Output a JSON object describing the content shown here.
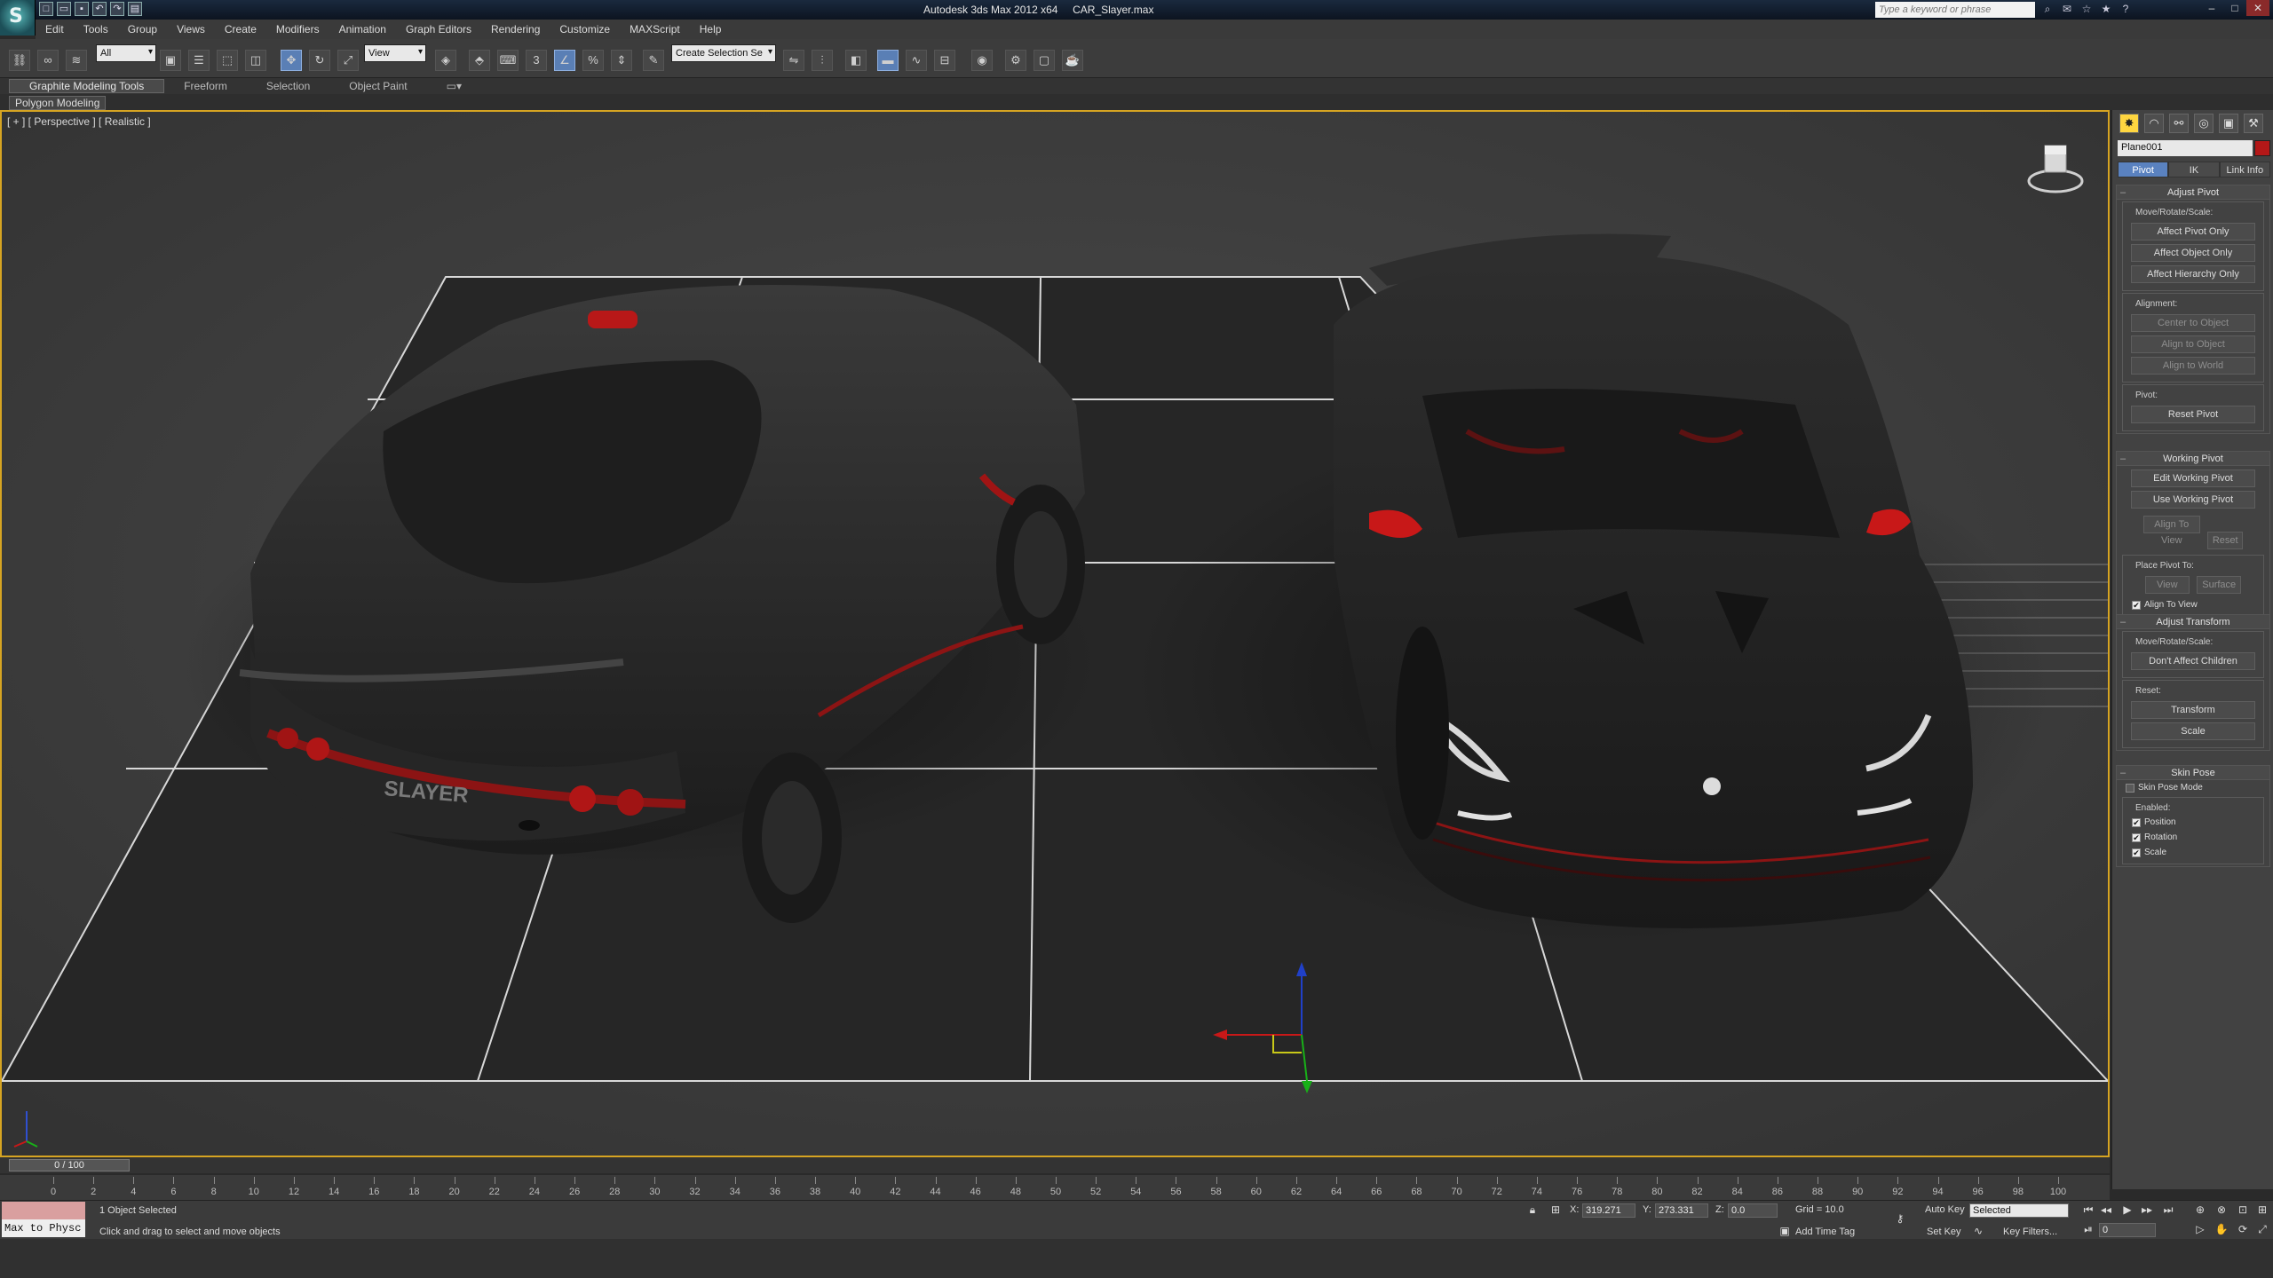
{
  "window": {
    "title_app": "Autodesk 3ds Max  2012 x64",
    "title_file": "CAR_Slayer.max",
    "search_placeholder": "Type a keyword or phrase"
  },
  "menu": [
    "Edit",
    "Tools",
    "Group",
    "Views",
    "Create",
    "Modifiers",
    "Animation",
    "Graph Editors",
    "Rendering",
    "Customize",
    "MAXScript",
    "Help"
  ],
  "toolbar": {
    "filter": "All",
    "refcoord": "View",
    "named_sel": "Create Selection Se"
  },
  "ribbon": {
    "tabs": [
      "Graphite Modeling Tools",
      "Freeform",
      "Selection",
      "Object Paint"
    ],
    "sub": "Polygon Modeling"
  },
  "viewport": {
    "label": "[ + ] [ Perspective ] [ Realistic ]",
    "badge": "SLAYER"
  },
  "panel": {
    "object_name": "Plane001",
    "subtabs": [
      "Pivot",
      "IK",
      "Link Info"
    ],
    "adjust_pivot": {
      "title": "Adjust Pivot",
      "move_label": "Move/Rotate/Scale:",
      "buttons": [
        "Affect Pivot Only",
        "Affect Object Only",
        "Affect Hierarchy Only"
      ],
      "alignment_label": "Alignment:",
      "align_buttons": [
        "Center to Object",
        "Align to Object",
        "Align to World"
      ],
      "pivot_label": "Pivot:",
      "reset": "Reset Pivot"
    },
    "working_pivot": {
      "title": "Working Pivot",
      "buttons": [
        "Edit Working Pivot",
        "Use Working Pivot"
      ],
      "align_view": "Align To View",
      "reset": "Reset",
      "place_label": "Place Pivot To:",
      "view": "View",
      "surface": "Surface",
      "align_to_view_chk": "Align To View"
    },
    "adjust_transform": {
      "title": "Adjust Transform",
      "move_label": "Move/Rotate/Scale:",
      "dont_affect": "Don't Affect Children",
      "reset_label": "Reset:",
      "transform": "Transform",
      "scale": "Scale"
    },
    "skin_pose": {
      "title": "Skin Pose",
      "mode": "Skin Pose Mode",
      "enabled_label": "Enabled:",
      "position": "Position",
      "rotation": "Rotation",
      "scale": "Scale"
    }
  },
  "timeline": {
    "frame": "0 / 100",
    "ticks": [
      0,
      2,
      4,
      6,
      8,
      10,
      12,
      14,
      16,
      18,
      20,
      22,
      24,
      26,
      28,
      30,
      32,
      34,
      36,
      38,
      40,
      42,
      44,
      46,
      48,
      50,
      52,
      54,
      56,
      58,
      60,
      62,
      64,
      66,
      68,
      70,
      72,
      74,
      76,
      78,
      80,
      82,
      84,
      86,
      88,
      90,
      92,
      94,
      96,
      98,
      100
    ]
  },
  "status": {
    "script": "Max to Physc",
    "selected": "1 Object Selected",
    "prompt": "Click and drag to select and move objects",
    "x_label": "X:",
    "x": "319.271",
    "y_label": "Y:",
    "y": "273.331",
    "z_label": "Z:",
    "z": "0.0",
    "grid": "Grid = 10.0",
    "add_time_tag": "Add Time Tag",
    "auto_key": "Auto Key",
    "set_key": "Set Key",
    "sel_mode": "Selected",
    "key_filters": "Key Filters...",
    "frame_field": "0"
  },
  "colors": {
    "viewport_border": "#d6a422",
    "accent_red": "#c81818"
  }
}
